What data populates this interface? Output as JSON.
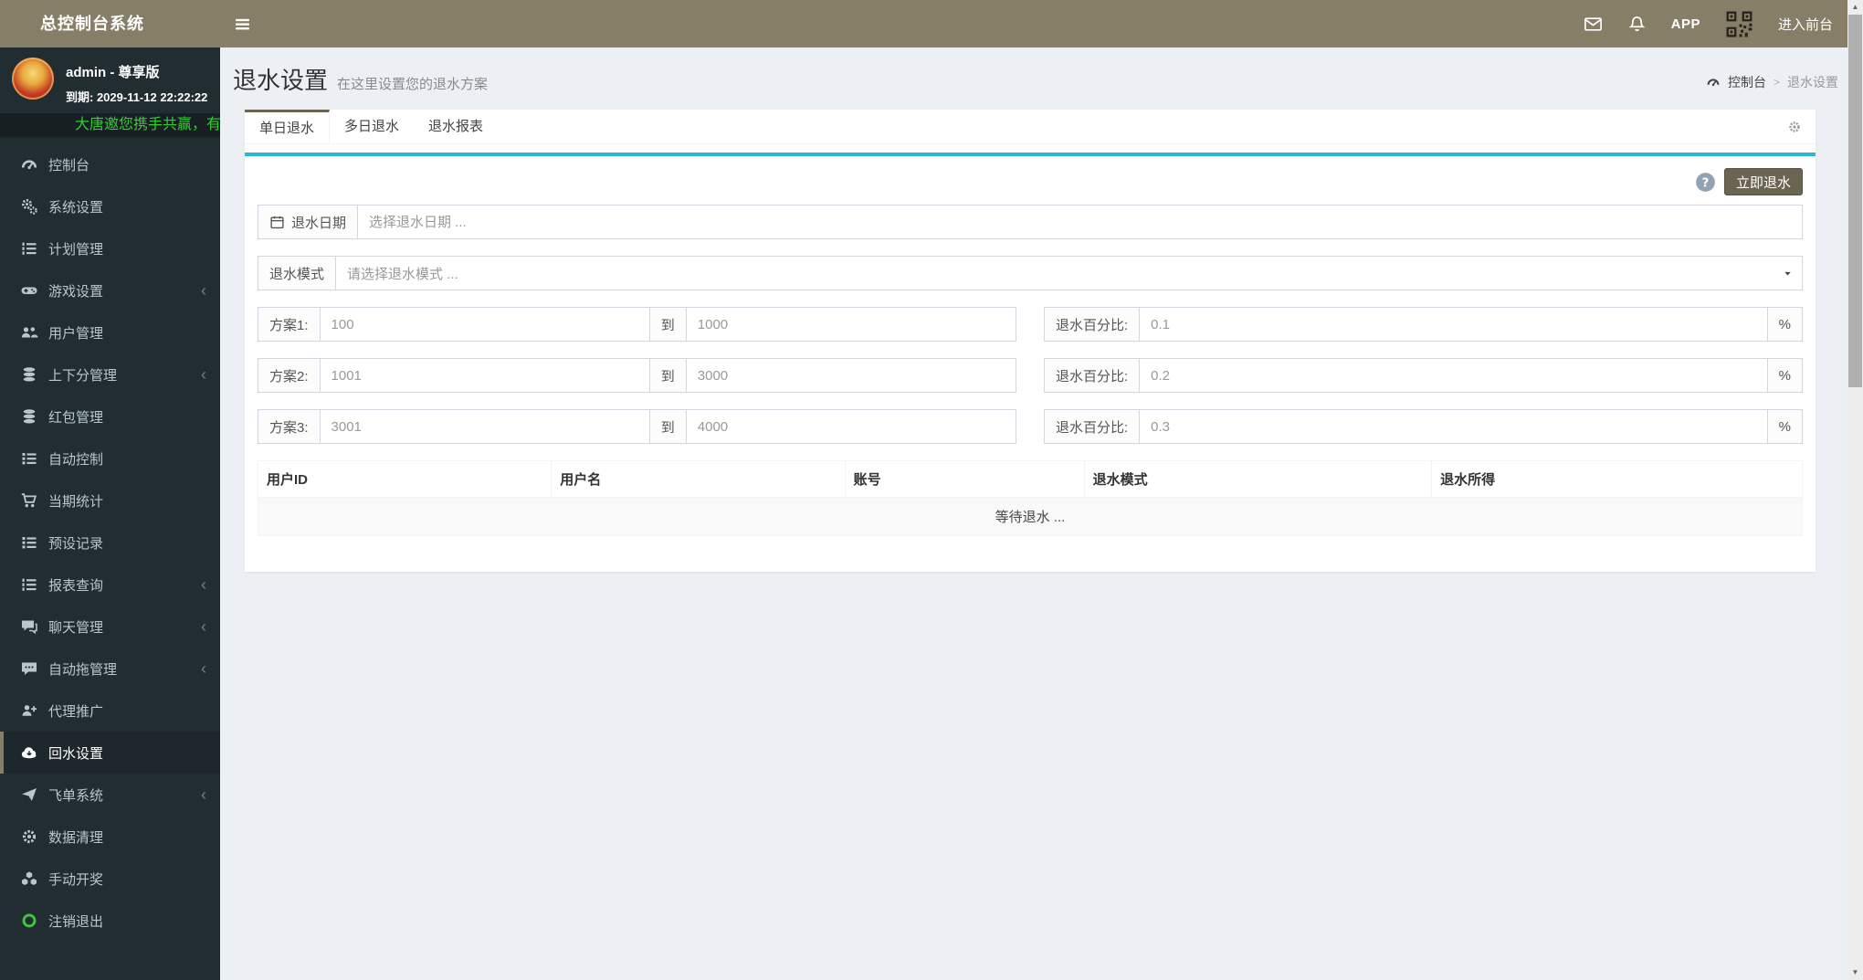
{
  "colors": {
    "navbar": "#867e66",
    "sidebar_bg": "#222d32",
    "active_item_bg": "#1e282c",
    "accent_tan": "#6b6452",
    "info_line": "#29b8ce",
    "marquee_green": "#33cc33",
    "logout_green": "#3fc23f",
    "content_bg": "#ecf0f5"
  },
  "navbar": {
    "brand": "总控制台系统",
    "app_label": "APP",
    "enter_frontend": "进入前台",
    "icons": [
      "envelope",
      "bell",
      "qr-code"
    ]
  },
  "sidebar": {
    "user": {
      "name": "admin - 尊享版",
      "expiry": "到期: 2029-11-12 22:22:22"
    },
    "marquee": "大唐邀您携手共赢，有",
    "chevron_char": "‹",
    "items": [
      {
        "label": "控制台",
        "icon": "dashboard"
      },
      {
        "label": "系统设置",
        "icon": "gears"
      },
      {
        "label": "计划管理",
        "icon": "list-ol"
      },
      {
        "label": "游戏设置",
        "icon": "gamepad",
        "has_submenu": true
      },
      {
        "label": "用户管理",
        "icon": "users"
      },
      {
        "label": "上下分管理",
        "icon": "coins",
        "has_submenu": true
      },
      {
        "label": "红包管理",
        "icon": "coins"
      },
      {
        "label": "自动控制",
        "icon": "list"
      },
      {
        "label": "当期统计",
        "icon": "cart"
      },
      {
        "label": "预设记录",
        "icon": "list"
      },
      {
        "label": "报表查询",
        "icon": "list-ol",
        "has_submenu": true
      },
      {
        "label": "聊天管理",
        "icon": "comments",
        "has_submenu": true
      },
      {
        "label": "自动拖管理",
        "icon": "comment-dots",
        "has_submenu": true
      },
      {
        "label": "代理推广",
        "icon": "user-plus"
      },
      {
        "label": "回水设置",
        "icon": "cloud-download",
        "active": true
      },
      {
        "label": "飞单系统",
        "icon": "paper-plane",
        "has_submenu": true
      },
      {
        "label": "数据清理",
        "icon": "gear"
      },
      {
        "label": "手动开奖",
        "icon": "cubes"
      },
      {
        "label": "注销退出",
        "icon": "logout-circle"
      }
    ]
  },
  "header": {
    "title": "退水设置",
    "subtitle": "在这里设置您的退水方案",
    "breadcrumb_home": "控制台",
    "breadcrumb_separator": ">",
    "breadcrumb_current": "退水设置"
  },
  "tabs": [
    {
      "label": "单日退水",
      "active": true
    },
    {
      "label": "多日退水",
      "active": false
    },
    {
      "label": "退水报表",
      "active": false
    }
  ],
  "panel": {
    "submit_button": "立即退水",
    "date_label": "退水日期",
    "date_placeholder": "选择退水日期 ...",
    "mode_label": "退水模式",
    "mode_placeholder": "请选择退水模式 ...",
    "to_label": "到",
    "pct_label": "退水百分比:",
    "pct_unit": "%",
    "plans": [
      {
        "label": "方案1:",
        "from": "100",
        "to": "1000",
        "pct": "0.1"
      },
      {
        "label": "方案2:",
        "from": "1001",
        "to": "3000",
        "pct": "0.2"
      },
      {
        "label": "方案3:",
        "from": "3001",
        "to": "4000",
        "pct": "0.3"
      }
    ],
    "table": {
      "headers": [
        "用户ID",
        "用户名",
        "账号",
        "退水模式",
        "退水所得"
      ],
      "empty_text": "等待退水 ..."
    }
  }
}
